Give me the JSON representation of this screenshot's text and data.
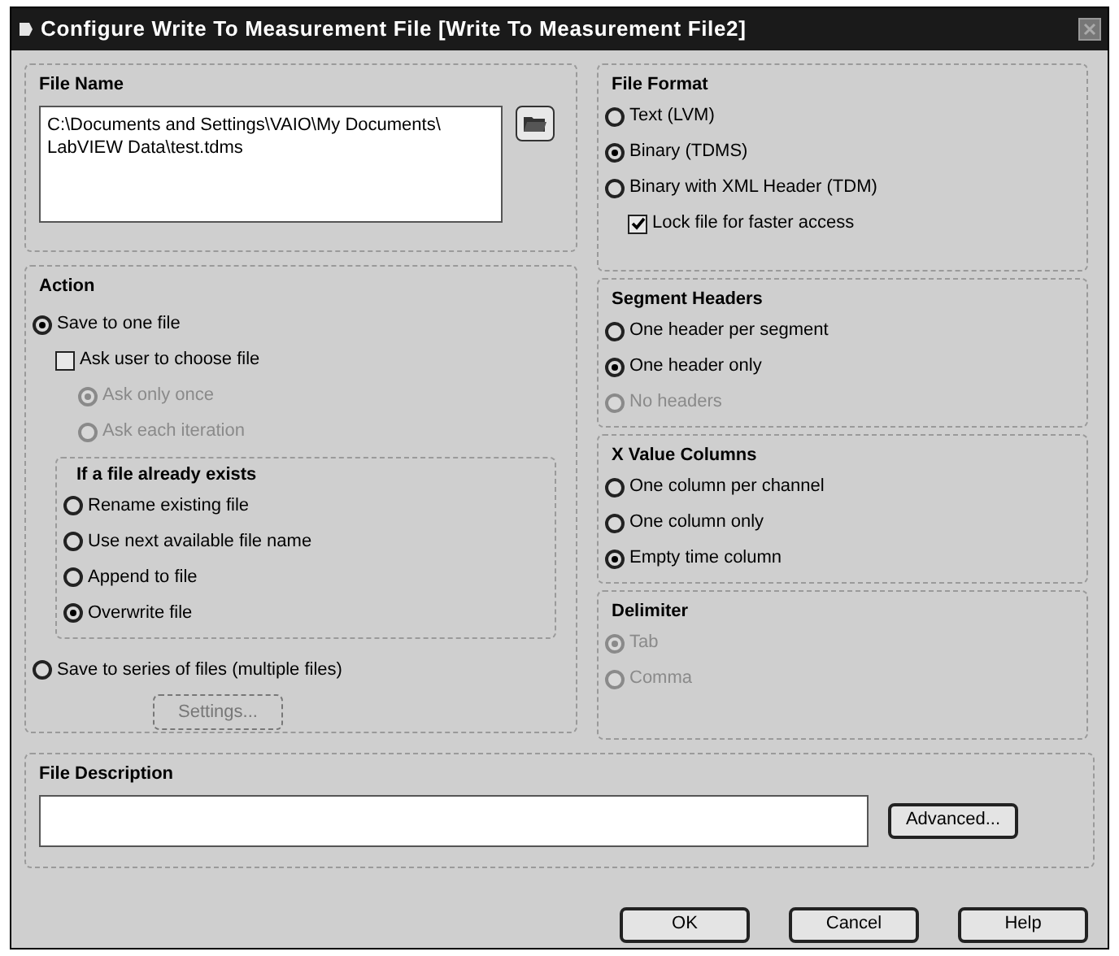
{
  "window": {
    "title": "Configure Write To Measurement File [Write To Measurement File2]"
  },
  "file_name": {
    "title": "File Name",
    "value": "C:\\Documents and Settings\\VAIO\\My Documents\\\nLabVIEW Data\\test.tdms"
  },
  "action": {
    "title": "Action",
    "items": [
      {
        "kind": "radio",
        "label": "Save to one file",
        "selected": true,
        "disabled": false,
        "children": [
          {
            "kind": "checkbox",
            "label": "Ask user to choose file",
            "checked": false,
            "disabled": false,
            "children": [
              {
                "kind": "radio",
                "label": "Ask only once",
                "selected": true,
                "disabled": true
              },
              {
                "kind": "radio",
                "label": "Ask each iteration",
                "selected": false,
                "disabled": true
              }
            ]
          },
          {
            "kind": "group",
            "title": "If a file already exists",
            "children": [
              {
                "kind": "radio",
                "label": "Rename existing file",
                "selected": false,
                "disabled": false
              },
              {
                "kind": "radio",
                "label": "Use next available file name",
                "selected": false,
                "disabled": false
              },
              {
                "kind": "radio",
                "label": "Append to file",
                "selected": false,
                "disabled": false
              },
              {
                "kind": "radio",
                "label": "Overwrite file",
                "selected": true,
                "disabled": false
              }
            ]
          }
        ]
      },
      {
        "kind": "radio",
        "label": "Save to series of files (multiple files)",
        "selected": false,
        "disabled": false,
        "children": [
          {
            "kind": "button",
            "label": "Settings...",
            "disabled": true
          }
        ]
      }
    ]
  },
  "right_groups": [
    {
      "title": "File Format",
      "items": [
        {
          "kind": "radio",
          "label": "Text (LVM)",
          "selected": false,
          "disabled": false
        },
        {
          "kind": "radio",
          "label": "Binary (TDMS)",
          "selected": true,
          "disabled": false
        },
        {
          "kind": "radio",
          "label": "Binary with XML Header (TDM)",
          "selected": false,
          "disabled": false,
          "children": [
            {
              "kind": "checkbox",
              "label": "Lock file for faster access",
              "checked": true,
              "disabled": false
            }
          ]
        }
      ]
    },
    {
      "title": "Segment Headers",
      "items": [
        {
          "kind": "radio",
          "label": "One header per segment",
          "selected": false,
          "disabled": false
        },
        {
          "kind": "radio",
          "label": "One header only",
          "selected": true,
          "disabled": false
        },
        {
          "kind": "radio",
          "label": "No headers",
          "selected": false,
          "disabled": true
        }
      ]
    },
    {
      "title": "X Value Columns",
      "items": [
        {
          "kind": "radio",
          "label": "One column per channel",
          "selected": false,
          "disabled": false
        },
        {
          "kind": "radio",
          "label": "One column only",
          "selected": false,
          "disabled": false
        },
        {
          "kind": "radio",
          "label": "Empty time column",
          "selected": true,
          "disabled": false
        }
      ]
    },
    {
      "title": "Delimiter",
      "items": [
        {
          "kind": "radio",
          "label": "Tab",
          "selected": true,
          "disabled": true
        },
        {
          "kind": "radio",
          "label": "Comma",
          "selected": false,
          "disabled": true
        }
      ]
    }
  ],
  "file_description": {
    "title": "File Description",
    "advanced_button": "Advanced..."
  },
  "buttons": [
    "OK",
    "Cancel",
    "Help"
  ]
}
